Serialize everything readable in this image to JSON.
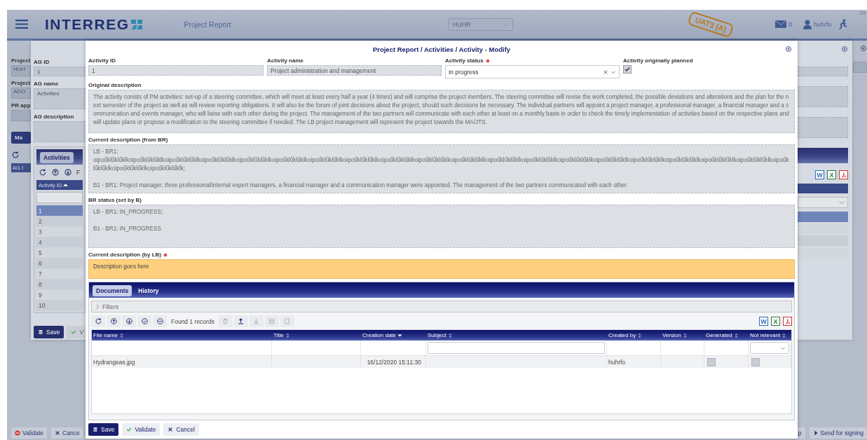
{
  "header": {
    "brand": "INTERREG",
    "page_title": "Project Report",
    "program": "HUHR",
    "environment": "UAT3 (A)",
    "unread_messages": "0",
    "user": "huhrfo",
    "clock": "29"
  },
  "back_page": {
    "fields": [
      {
        "label": "Project",
        "value": "HUH"
      },
      {
        "label": "Project",
        "value": "ADO"
      },
      {
        "label": "PR app"
      }
    ],
    "tab": "Ma",
    "column": "AG I",
    "footer_left": [
      {
        "kind": "validate",
        "label": "Validate"
      },
      {
        "kind": "cancel",
        "label": "Cance"
      }
    ],
    "footer_right": [
      {
        "kind": "plain",
        "label": "p"
      },
      {
        "kind": "send",
        "label": "Send for signing"
      }
    ]
  },
  "group_dialog": {
    "fields": [
      {
        "label": "AG ID",
        "value": "1",
        "kind": "line"
      },
      {
        "label": "AG name",
        "value": "Activities",
        "kind": "area"
      },
      {
        "label": "AG description",
        "kind": "area"
      }
    ],
    "tabs": [
      {
        "label": "Activities",
        "selected": true
      }
    ],
    "toolbar": [
      {
        "kind": "refresh"
      },
      {
        "kind": "move-up"
      },
      {
        "kind": "move-down"
      }
    ],
    "toolbar_text": "F",
    "column": {
      "label": "Activity ID",
      "sorted": true,
      "descending": false
    },
    "rows": [
      {
        "id": "1",
        "selected": true
      },
      {
        "id": "2",
        "selected": false
      },
      {
        "id": "3",
        "selected": false
      },
      {
        "id": "4",
        "selected": false
      },
      {
        "id": "5",
        "selected": false
      },
      {
        "id": "6",
        "selected": false
      },
      {
        "id": "7",
        "selected": false
      },
      {
        "id": "8",
        "selected": false
      },
      {
        "id": "9",
        "selected": false
      },
      {
        "id": "10",
        "selected": false
      }
    ],
    "buttons": [
      {
        "kind": "save",
        "label": "Save"
      },
      {
        "kind": "validate",
        "label": "V"
      }
    ],
    "exports": [
      {
        "kind": "word",
        "glyph": "W"
      },
      {
        "kind": "excel",
        "glyph": "X"
      },
      {
        "kind": "pdf"
      }
    ]
  },
  "activity_dialog": {
    "title": "Project Report / Activities / Activity - Modify",
    "fields": [
      {
        "kind": "text",
        "label": "Activity ID",
        "value": "1"
      },
      {
        "kind": "text",
        "label": "Activity name",
        "value": "Project administration and management"
      },
      {
        "kind": "select",
        "label": "Activity status",
        "required": true,
        "value": "In progress"
      },
      {
        "kind": "checkbox",
        "label": "Activity originally planned",
        "checked": true
      }
    ],
    "descriptions": [
      {
        "kind": "readonly",
        "label": "Original description",
        "value": "The activity conists of PM activities: set-up of a steering committee, which will meet at least every half a year (4 times) and will comprise the project members. The steering committee will revise the work completed, the possible deviations and alterations and the plan for the next semester of the project as well as will review reporting obligations. It will also be the forum of joint decisions about the project, should such decisions be necessary. The individual partners will appoint a project manager, a professional manager, a financial manager and a communication and events manager, who will liaise with each other during the project. The management of the two partners will communicate with each other at least on a monthly basis in order to check the timely implementation of activities based on the respective plans and will update plans or propose a modification to the steering committee if needed. The LB project management will represent the project towards the MA/JTS."
      },
      {
        "kind": "readonly",
        "label": "Current description (from BR)",
        "value": "LB - BR1:\noipoűklűklűklkoipoűklűklűklkoipoűklűklűklkoipoűklűklűklkoipoűklűklűklkoipoűklűklűklkoipoűklűklűklkoipoűklűklűklkoipoűklűklűklkoipoűklűklűklkoipoűklűklűklkoipoűklűklűklkoipoűklűklűklkoipoűklűklűklkoipoűklűklűklkoipoűklűklűklkoipoűklűklűklkoipoűklűklűklkoipoűklűklűklkoipoűklűklűklkoipoűklűklűklkoipoűklűklűklk;\n\nB1 - BR1: Project manager, three professional/internal expert managers, a financial manager and a communication manager were appointed. The management of the two partners communicated with each other."
      },
      {
        "kind": "readonly",
        "label": "BR status (set by B)",
        "value": "LB - BR1: IN_PROGRESS;\n\nB1 - BR1: IN_PROGRESS"
      },
      {
        "kind": "editable",
        "label": "Current description (by LB)",
        "required": true,
        "value": "Description goes here"
      }
    ],
    "tabs": [
      {
        "label": "Documents",
        "selected": true
      },
      {
        "label": "History",
        "selected": false
      }
    ],
    "filters_label": "Filters",
    "toolbar_left": [
      {
        "kind": "refresh",
        "disabled": false
      },
      {
        "kind": "move-up",
        "disabled": false
      },
      {
        "kind": "move-down",
        "disabled": false
      },
      {
        "kind": "select-all",
        "disabled": false
      },
      {
        "kind": "deselect-all",
        "disabled": false
      }
    ],
    "records": "Found 1 records",
    "toolbar_right": [
      {
        "kind": "delete",
        "disabled": true
      },
      {
        "kind": "upload",
        "disabled": false
      },
      {
        "kind": "download",
        "disabled": true
      },
      {
        "kind": "archive",
        "disabled": true
      },
      {
        "kind": "checkbox",
        "disabled": true
      }
    ],
    "exports": [
      {
        "kind": "word",
        "glyph": "W"
      },
      {
        "kind": "excel",
        "glyph": "X"
      },
      {
        "kind": "pdf"
      }
    ],
    "columns": [
      {
        "label": "File name",
        "sorted": false
      },
      {
        "label": "Title",
        "sorted": false
      },
      {
        "label": "Creation date",
        "sorted": true,
        "descending": true
      },
      {
        "label": "Subject",
        "sorted": false
      },
      {
        "label": "Created by",
        "sorted": false
      },
      {
        "label": "Version",
        "sorted": false
      },
      {
        "label": "Generated",
        "sorted": false
      },
      {
        "label": "Not relevant",
        "sorted": false
      }
    ],
    "column_filters": [
      {
        "kind": "empty"
      },
      {
        "kind": "empty"
      },
      {
        "kind": "empty"
      },
      {
        "kind": "text"
      },
      {
        "kind": "empty"
      },
      {
        "kind": "empty"
      },
      {
        "kind": "empty"
      },
      {
        "kind": "select"
      }
    ],
    "rows": [
      {
        "file_name": "Hydrangeas.jpg",
        "creation_date": "16/12/2020 15:11:30",
        "created_by": "huhrfo",
        "generated": false,
        "not_relevant": false
      }
    ],
    "buttons": [
      {
        "kind": "save",
        "label": "Save"
      },
      {
        "kind": "validate",
        "label": "Validate"
      },
      {
        "kind": "cancel",
        "label": "Cancel"
      }
    ]
  }
}
